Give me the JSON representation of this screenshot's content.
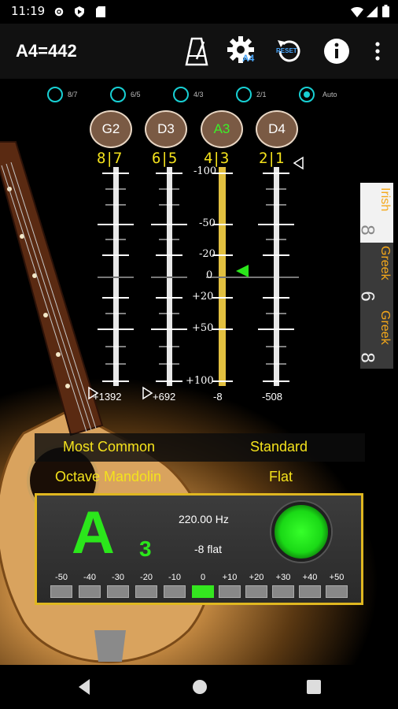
{
  "status": {
    "time": "11:19"
  },
  "appbar": {
    "title": "A4=442",
    "a4_badge": "A4",
    "reset_label": "RESET"
  },
  "temperament": {
    "options": [
      "8/7",
      "6/5",
      "4/3",
      "2/1",
      "Auto"
    ],
    "selected": "Auto"
  },
  "strings": [
    {
      "note": "G2",
      "ratio": "8|7",
      "offset": "+1392",
      "active": false
    },
    {
      "note": "D3",
      "ratio": "6|5",
      "offset": "+692",
      "active": false
    },
    {
      "note": "A3",
      "ratio": "4|3",
      "offset": "-8",
      "active": true
    },
    {
      "note": "D4",
      "ratio": "2|1",
      "offset": "-508",
      "active": false
    }
  ],
  "scale_labels": [
    "-100",
    "-50",
    "-20",
    "0",
    "+20",
    "+50",
    "+100"
  ],
  "side_tabs": [
    {
      "label": "Irish",
      "number": "8"
    },
    {
      "label": "Greek",
      "number": "6"
    },
    {
      "label": "Greek",
      "number": "8"
    }
  ],
  "info": {
    "row1_left": "Most Common",
    "row1_right": "Standard",
    "row2_left": "Octave Mandolin",
    "row2_right": "Flat"
  },
  "readout": {
    "note": "A",
    "octave": "3",
    "frequency": "220.00 Hz",
    "deviation": "-8 flat",
    "cents_labels": [
      "-50",
      "-40",
      "-30",
      "-20",
      "-10",
      "0",
      "+10",
      "+20",
      "+30",
      "+40",
      "+50"
    ],
    "active_index": 5,
    "led_color": "#2be61b"
  },
  "colors": {
    "accent_yellow": "#f4e21c",
    "accent_green": "#2be61b",
    "radio_cyan": "#18d0d4"
  }
}
